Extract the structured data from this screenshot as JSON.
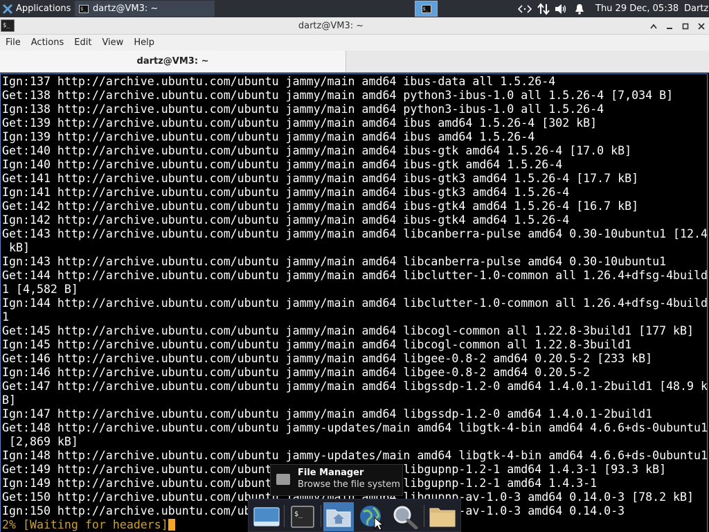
{
  "top_panel": {
    "applications_label": "Applications",
    "task_label": "dartz@VM3: ~",
    "clock": "Thu 29 Dec, 05:38",
    "user": "Dartz"
  },
  "window": {
    "title": "dartz@VM3: ~",
    "menu": [
      "File",
      "Actions",
      "Edit",
      "View",
      "Help"
    ],
    "tab_label": "dartz@VM3: ~"
  },
  "terminal": {
    "lines": [
      "Ign:137 http://archive.ubuntu.com/ubuntu jammy/main amd64 ibus-data all 1.5.26-4",
      "Get:138 http://archive.ubuntu.com/ubuntu jammy/main amd64 python3-ibus-1.0 all 1.5.26-4 [7,034 B]",
      "Ign:138 http://archive.ubuntu.com/ubuntu jammy/main amd64 python3-ibus-1.0 all 1.5.26-4",
      "Get:139 http://archive.ubuntu.com/ubuntu jammy/main amd64 ibus amd64 1.5.26-4 [302 kB]",
      "Ign:139 http://archive.ubuntu.com/ubuntu jammy/main amd64 ibus amd64 1.5.26-4",
      "Get:140 http://archive.ubuntu.com/ubuntu jammy/main amd64 ibus-gtk amd64 1.5.26-4 [17.0 kB]",
      "Ign:140 http://archive.ubuntu.com/ubuntu jammy/main amd64 ibus-gtk amd64 1.5.26-4",
      "Get:141 http://archive.ubuntu.com/ubuntu jammy/main amd64 ibus-gtk3 amd64 1.5.26-4 [17.7 kB]",
      "Ign:141 http://archive.ubuntu.com/ubuntu jammy/main amd64 ibus-gtk3 amd64 1.5.26-4",
      "Get:142 http://archive.ubuntu.com/ubuntu jammy/main amd64 ibus-gtk4 amd64 1.5.26-4 [16.7 kB]",
      "Ign:142 http://archive.ubuntu.com/ubuntu jammy/main amd64 ibus-gtk4 amd64 1.5.26-4",
      "Get:143 http://archive.ubuntu.com/ubuntu jammy/main amd64 libcanberra-pulse amd64 0.30-10ubuntu1 [12.4",
      " kB]",
      "Ign:143 http://archive.ubuntu.com/ubuntu jammy/main amd64 libcanberra-pulse amd64 0.30-10ubuntu1",
      "Get:144 http://archive.ubuntu.com/ubuntu jammy/main amd64 libclutter-1.0-common all 1.26.4+dfsg-4build",
      "1 [4,582 B]",
      "Ign:144 http://archive.ubuntu.com/ubuntu jammy/main amd64 libclutter-1.0-common all 1.26.4+dfsg-4build",
      "1",
      "Get:145 http://archive.ubuntu.com/ubuntu jammy/main amd64 libcogl-common all 1.22.8-3build1 [177 kB]",
      "Ign:145 http://archive.ubuntu.com/ubuntu jammy/main amd64 libcogl-common all 1.22.8-3build1",
      "Get:146 http://archive.ubuntu.com/ubuntu jammy/main amd64 libgee-0.8-2 amd64 0.20.5-2 [233 kB]",
      "Ign:146 http://archive.ubuntu.com/ubuntu jammy/main amd64 libgee-0.8-2 amd64 0.20.5-2",
      "Get:147 http://archive.ubuntu.com/ubuntu jammy/main amd64 libgssdp-1.2-0 amd64 1.4.0.1-2build1 [48.9 k",
      "B]",
      "Ign:147 http://archive.ubuntu.com/ubuntu jammy/main amd64 libgssdp-1.2-0 amd64 1.4.0.1-2build1",
      "Get:148 http://archive.ubuntu.com/ubuntu jammy-updates/main amd64 libgtk-4-bin amd64 4.6.6+ds-0ubuntu1",
      " [2,869 kB]",
      "Ign:148 http://archive.ubuntu.com/ubuntu jammy-updates/main amd64 libgtk-4-bin amd64 4.6.6+ds-0ubuntu1",
      "Get:149 http://archive.ubuntu.com/ubuntu jammy/main amd64 libgupnp-1.2-1 amd64 1.4.3-1 [93.3 kB]",
      "Ign:149 http://archive.ubuntu.com/ubuntu jammy/main amd64 libgupnp-1.2-1 amd64 1.4.3-1",
      "Get:150 http://archive.ubuntu.com/ubuntu jammy/main amd64 libgupnp-av-1.0-3 amd64 0.14.0-3 [78.2 kB]",
      "Ign:150 http://archive.ubuntu.com/ubuntu jammy/main amd64 libgupnp-av-1.0-3 amd64 0.14.0-3"
    ],
    "progress_line": "2% [Waiting for headers]"
  },
  "tooltip": {
    "title": "File Manager",
    "subtitle": "Browse the file system"
  },
  "dock": {
    "items": [
      "show-desktop-icon",
      "terminal-icon",
      "home-folder-icon",
      "web-browser-icon",
      "search-icon",
      "folder-icon"
    ]
  },
  "colors": {
    "panel_bg": "#2c2f36",
    "workspace_accent": "#5fa0d8",
    "terminal_bg": "#000000",
    "terminal_fg": "#ffffff",
    "progress_fg": "#c8a13c",
    "cursor": "#f5a623"
  }
}
